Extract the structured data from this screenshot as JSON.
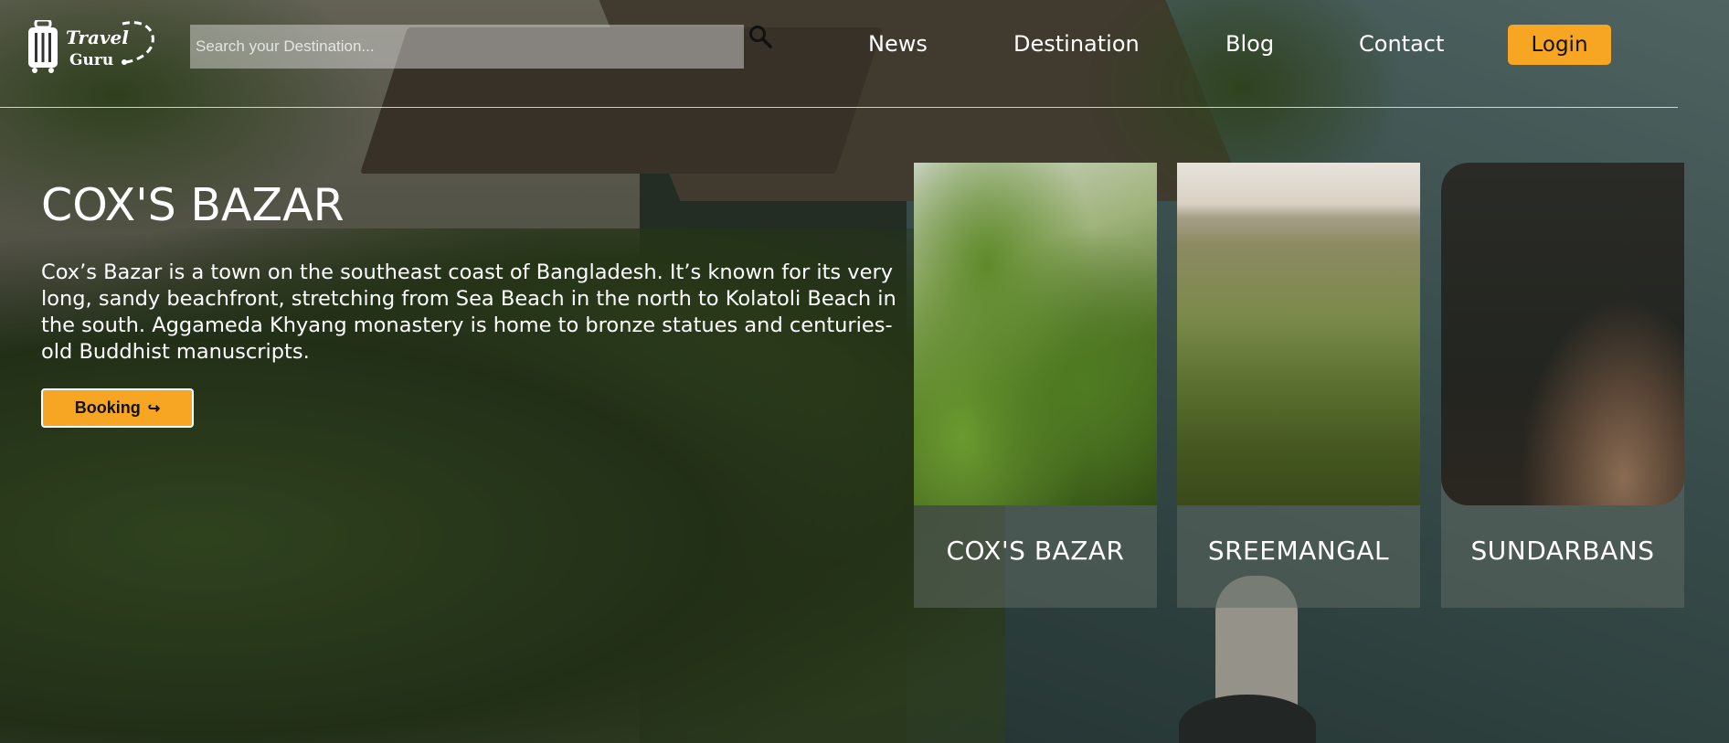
{
  "logo": {
    "line1": "Travel",
    "line2": "Guru"
  },
  "search": {
    "placeholder": "Search your Destination..."
  },
  "nav": {
    "news": "News",
    "destination": "Destination",
    "blog": "Blog",
    "contact": "Contact"
  },
  "login_label": "Login",
  "hero": {
    "title": "COX'S BAZAR",
    "description": "Cox’s Bazar is a town on the southeast coast of Bangladesh. It’s known for its very long, sandy beachfront, stretching from Sea Beach in the north to Kolatoli Beach in the south. Aggameda Khyang monastery is home to bronze statues and centuries-old Buddhist manuscripts.",
    "booking_label": "Booking",
    "booking_icon": "↪"
  },
  "cards": [
    {
      "label": "COX'S BAZAR"
    },
    {
      "label": "SREEMANGAL"
    },
    {
      "label": "SUNDARBANS"
    }
  ],
  "colors": {
    "accent": "#f6a623"
  },
  "icons": {
    "search": "search-icon",
    "logo": "suitcase-icon",
    "booking": "arrow-icon"
  }
}
